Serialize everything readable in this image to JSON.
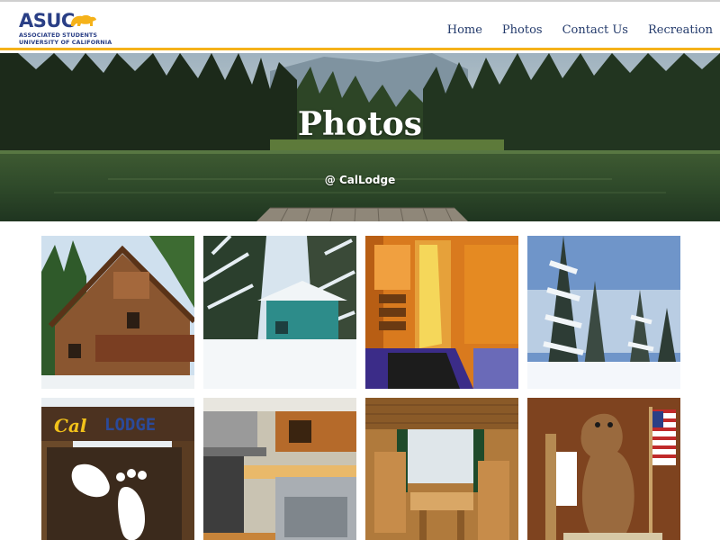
{
  "logo": {
    "wordmark": "ASUC",
    "line1": "ASSOCIATED STUDENTS",
    "line2": "UNIVERSITY OF CALIFORNIA",
    "colors": {
      "navy": "#2a3f86",
      "gold": "#f5b21a"
    }
  },
  "nav": {
    "items": [
      {
        "label": "Home"
      },
      {
        "label": "Photos"
      },
      {
        "label": "Contact Us"
      },
      {
        "label": "Recreation"
      }
    ]
  },
  "hero": {
    "title": "Photos",
    "subtitle": "@ CalLodge"
  },
  "gallery": {
    "photos": [
      {
        "name": "lodge-exterior-cabin"
      },
      {
        "name": "lodge-in-snow"
      },
      {
        "name": "interior-hallway-stairs"
      },
      {
        "name": "snowy-forest"
      },
      {
        "name": "cal-lodge-sign",
        "sign_text_1": "Cal",
        "sign_text_2": "LODGE"
      },
      {
        "name": "kitchen"
      },
      {
        "name": "dining-nook"
      },
      {
        "name": "bear-statue"
      }
    ]
  }
}
